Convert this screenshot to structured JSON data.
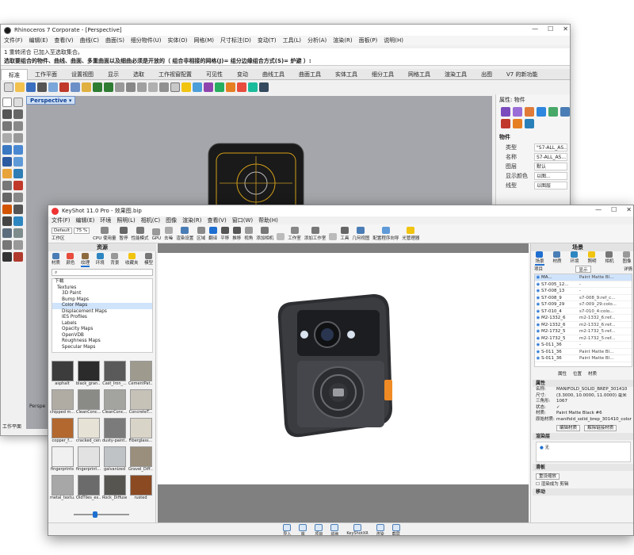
{
  "rhino": {
    "title": "Rhinoceros 7 Corporate - [Perspective]",
    "menu": [
      "文件(F)",
      "编辑(E)",
      "查看(V)",
      "曲线(C)",
      "曲面(S)",
      "细分物件(U)",
      "实体(O)",
      "网格(M)",
      "尺寸标注(D)",
      "变动(T)",
      "工具(L)",
      "分析(A)",
      "渲染(R)",
      "面板(P)",
      "说明(H)"
    ],
    "command_history": "1 重转闭合 已加入至选取集合。",
    "command_prompt": "选取要组合的物件、曲线、曲面、多重曲面以及细曲必须是开放的（ 组合非相接的网格(J)= 组分边缘组合方式(S)= 炉避 ）:",
    "tabs": [
      "标准",
      "工作平面",
      "设置视图",
      "显示",
      "选取",
      "工作视窗配置",
      "可见性",
      "变动",
      "曲线工具",
      "曲面工具",
      "实体工具",
      "细分工具",
      "网格工具",
      "渲染工具",
      "出图",
      "V7 的新功能"
    ],
    "active_tab": "标准",
    "viewport_label": "Perspective",
    "properties": {
      "panel_title": "属性: 物件",
      "section": "物件",
      "rows": [
        {
          "k": "类型",
          "v": "\"S7-ALL_AS..."
        },
        {
          "k": "名称",
          "v": "S7-ALL_AS..."
        },
        {
          "k": "图层",
          "v": "默认"
        },
        {
          "k": "显示颜色",
          "v": "以图..."
        },
        {
          "k": "线型",
          "v": "以图层"
        }
      ]
    },
    "status_left": "工作平面",
    "status_tag": "Perspe"
  },
  "keyshot": {
    "title": "KeyShot 11.0 Pro - 效果图.bip",
    "menu": [
      "文件(F)",
      "编辑(E)",
      "环境",
      "照明(L)",
      "相机(C)",
      "图像",
      "渲染(R)",
      "查看(V)",
      "窗口(W)",
      "帮助(H)"
    ],
    "toolbar": {
      "mode": "Default",
      "zoom": "75 %",
      "cores_label": "CPU 使用量",
      "buttons": [
        "工作区",
        "CPU 使用量",
        "暂停",
        "性能模式",
        "GPU",
        "去噪",
        "渲染设置",
        "区域",
        "翻译",
        "平移",
        "推移",
        "视角",
        "添加相机",
        "",
        "工作室",
        "添加工作室",
        "",
        "工具",
        "几何视图",
        "配置程序向导",
        "光管理器"
      ]
    },
    "library": {
      "title": "资源",
      "tabs": [
        "材质",
        "颜色",
        "纹理",
        "环境",
        "背景",
        "收藏夹",
        "模型"
      ],
      "search_placeholder": "",
      "tree": [
        "Textures",
        "3D Paint",
        "Bump Maps",
        "Color Maps",
        "Displacement Maps",
        "IES Profiles",
        "Labels",
        "Opacity Maps",
        "OpenVDB",
        "Roughness Maps",
        "Specular Maps",
        "Vinyl"
      ],
      "tree_root": "下载",
      "selected": "Color Maps",
      "thumbs": [
        "asphalt",
        "black_gran...",
        "Cast_Iron_...",
        "CementPat...",
        "chipped m...",
        "CleanConc...",
        "CleanConc...",
        "ConcreteT...",
        "copper_f...",
        "cracked_ceram...",
        "dusty-paint...",
        "Fiberglass...",
        "fingerprints",
        "fingerprint...",
        "galvanized",
        "Gravel_Diff...",
        "metal_textu...",
        "OldTiles_ex...",
        "Rock_Diffuse",
        "rusted"
      ]
    },
    "scene": {
      "title": "场景",
      "tabs": [
        "场景",
        "材质",
        "环境",
        "照明",
        "相机",
        "图像"
      ],
      "filter": "显示",
      "columns": [
        "项目",
        "详情"
      ],
      "rows": [
        {
          "n": "MA...",
          "m": "Paint Matte Bl..."
        },
        {
          "n": "S7-005_12...",
          "m": "-"
        },
        {
          "n": "S7-008_13",
          "m": "-"
        },
        {
          "n": "S7-008_9",
          "m": "s7-008_9:ref_c..."
        },
        {
          "n": "S7-009_29",
          "m": "s7-009_29:colo..."
        },
        {
          "n": "S7-010_4",
          "m": "s7-010_4:colo..."
        },
        {
          "n": "M2-1332_6",
          "m": "m2-1332_6:ref..."
        },
        {
          "n": "M2-1332_6",
          "m": "m2-1332_6:ref..."
        },
        {
          "n": "M2-1732_5",
          "m": "m2-1732_5:ref..."
        },
        {
          "n": "M2-1732_5",
          "m": "m2-1732_5:ref..."
        },
        {
          "n": "S-011_36",
          "m": "-"
        },
        {
          "n": "S-011_36",
          "m": "Paint Matte Bl..."
        },
        {
          "n": "S-011_36",
          "m": "Paint Matte Bl..."
        }
      ],
      "subtabs": [
        "属性",
        "位置",
        "材质"
      ],
      "section_props": "属性",
      "props": [
        {
          "k": "名称:",
          "v": "MANIFOLD_SOLID_BREP_301410"
        },
        {
          "k": "尺寸:",
          "v": "(3.3000, 10.0000, 11.0000) 毫米"
        },
        {
          "k": "三角形:",
          "v": "1067"
        },
        {
          "k": "状态:",
          "v": "✓"
        },
        {
          "k": "材质:",
          "v": "Paint Matte Black #6"
        },
        {
          "k": "原始材质:",
          "v": "manifold_solid_brep_301410_color"
        }
      ],
      "btn_edit": "编辑材质",
      "btn_unlink": "解除链接材质",
      "section_render": "渲染层",
      "render_none": "无",
      "section_misc": "滑板",
      "btn_reset": "重设缩放",
      "chk_label": "渲染成为 剪辑",
      "section_anim": "移动"
    },
    "bottom": [
      "导入",
      "库",
      "项目",
      "动画",
      "KeyShotXR",
      "渲染",
      "截屏"
    ]
  }
}
